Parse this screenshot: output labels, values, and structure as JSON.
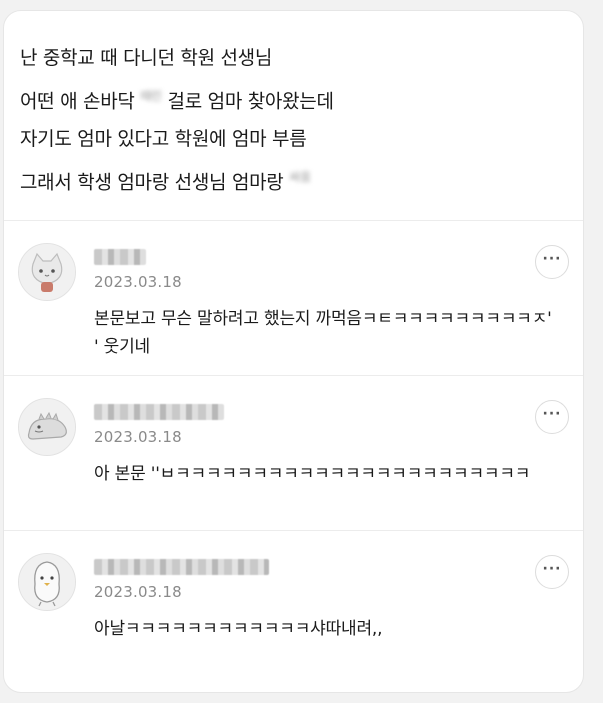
{
  "post": {
    "lines": [
      "난 중학교 때 다니던 학원 선생님",
      "어떤 애 손바닥 ",
      "자기도 엄마 있다고 학원에 엄마 부름",
      "그래서 학생 엄마랑 선생님 엄마랑 "
    ],
    "line2_censor": "때린",
    "line2_tail": " 걸로 엄마 찾아왔는데",
    "line4_censor": "싸움"
  },
  "comments": [
    {
      "date": "2023.03.18",
      "text": "본문보고 무슨 말하려고 했는지 까먹음ㅋㅌㅋㅋㅋㅋㅋㅋㅋㅋㅋㅈ' ' 웃기네",
      "avatar_icon": "cat-icon"
    },
    {
      "date": "2023.03.18",
      "text": "아 본문 ''ㅂㅋㅋㅋㅋㅋㅋㅋㅋㅋㅋㅋㅋㅋㅋㅋㅋㅋㅋㅋㅋㅋㅋㅋ",
      "avatar_icon": "dinosaur-icon"
    },
    {
      "date": "2023.03.18",
      "text": "아날ㅋㅋㅋㅋㅋㅋㅋㅋㅋㅋㅋㅋ샤따내려,,",
      "avatar_icon": "penguin-icon"
    }
  ],
  "more_button": "···"
}
